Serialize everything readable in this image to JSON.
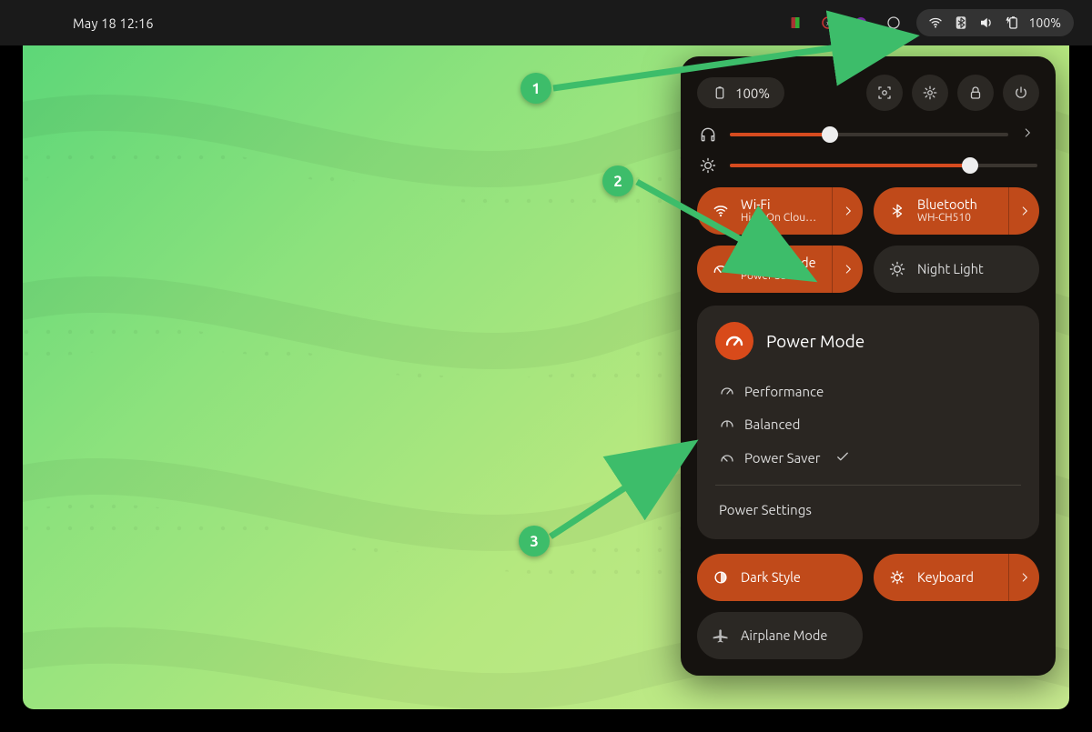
{
  "topbar": {
    "datetime": "May 18  12:16",
    "battery_percent": "100%"
  },
  "panel": {
    "battery": "100%",
    "sliders": {
      "volume_pct": 36,
      "brightness_pct": 78
    },
    "tiles": {
      "wifi": {
        "label": "Wi-Fi",
        "sub": "High On Clou…"
      },
      "bluetooth": {
        "label": "Bluetooth",
        "sub": "WH-CH510"
      },
      "powermode": {
        "label": "Power Mode",
        "sub": "Power Saver"
      },
      "nightlight": {
        "label": "Night Light"
      },
      "darkstyle": {
        "label": "Dark Style"
      },
      "keyboard": {
        "label": "Keyboard"
      },
      "airplane": {
        "label": "Airplane Mode"
      }
    },
    "power_submenu": {
      "title": "Power Mode",
      "options": {
        "performance": "Performance",
        "balanced": "Balanced",
        "saver": "Power Saver"
      },
      "selected": "saver",
      "settings_link": "Power Settings"
    }
  },
  "annotations": {
    "step1": "1",
    "step2": "2",
    "step3": "3"
  },
  "colors": {
    "accent": "#d64b1f",
    "callout": "#3dbd6a"
  }
}
